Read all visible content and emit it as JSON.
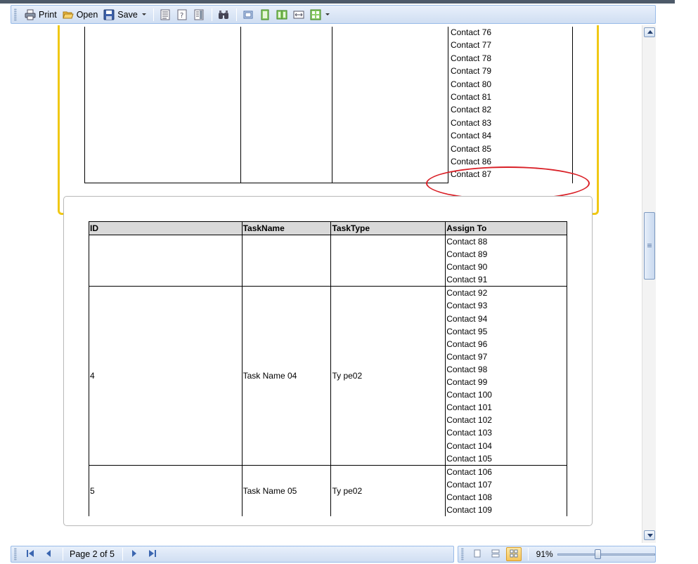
{
  "toolbar": {
    "print_label": "Print",
    "open_label": "Open",
    "save_label": "Save"
  },
  "page1": {
    "contacts": [
      "Contact 76",
      "Contact 77",
      "Contact 78",
      "Contact 79",
      "Contact 80",
      "Contact 81",
      "Contact 82",
      "Contact 83",
      "Contact 84",
      "Contact 85",
      "Contact 86",
      "Contact 87"
    ]
  },
  "page2": {
    "headers": [
      "ID",
      "TaskName",
      "TaskType",
      "Assign To"
    ],
    "rows": [
      {
        "id": "",
        "task_name": "",
        "task_type": "",
        "contacts": [
          "Contact 88",
          "Contact 89",
          "Contact 90",
          "Contact 91"
        ]
      },
      {
        "id": "4",
        "task_name": "Task Name 04",
        "task_type": "Ty pe02",
        "contacts": [
          "Contact 92",
          "Contact 93",
          "Contact 94",
          "Contact 95",
          "Contact 96",
          "Contact 97",
          "Contact 98",
          "Contact 99",
          "Contact 100",
          "Contact 101",
          "Contact 102",
          "Contact 103",
          "Contact 104",
          "Contact 105"
        ]
      },
      {
        "id": "5",
        "task_name": "Task Name 05",
        "task_type": "Ty pe02",
        "contacts": [
          "Contact 106",
          "Contact 107",
          "Contact 108",
          "Contact 109"
        ]
      }
    ]
  },
  "status": {
    "page_label": "Page 2 of 5",
    "zoom_label": "91%",
    "zoom_fraction": 0.4
  },
  "colors": {
    "highlight_border": "#f0c815",
    "annotation": "#d91f26"
  }
}
